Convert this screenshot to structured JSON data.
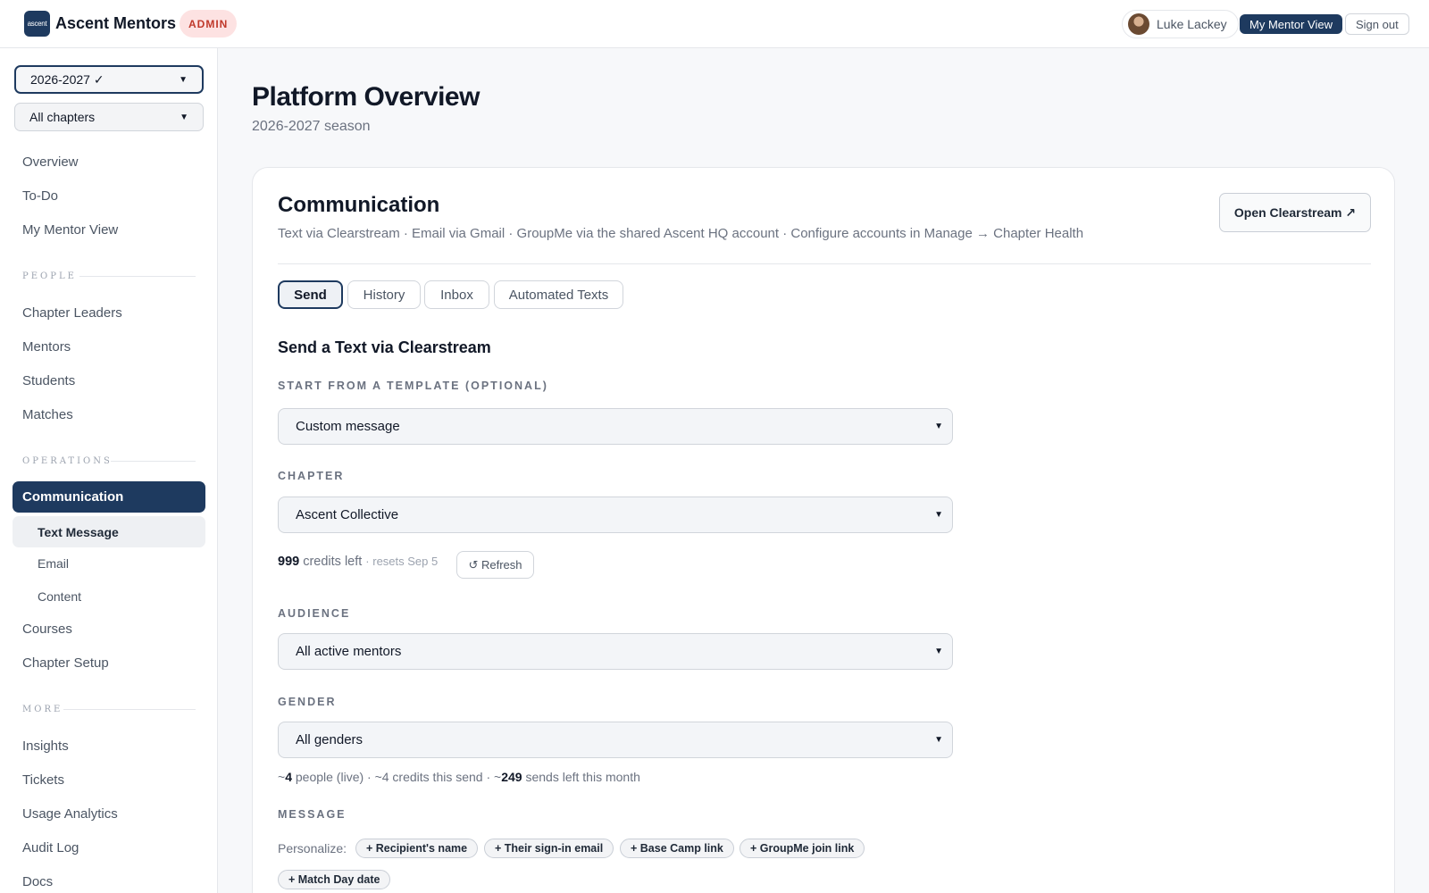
{
  "header": {
    "logo_text": "ascent",
    "brand": "Ascent Mentors",
    "badge": "ADMIN",
    "user_name": "Luke Lackey",
    "mentor_view_label": "My Mentor View",
    "sign_out_label": "Sign out"
  },
  "sidebar": {
    "season_select": "2026-2027 ✓",
    "chapter_select": "All chapters",
    "top_items": [
      "Overview",
      "To-Do",
      "My Mentor View"
    ],
    "people_label": "PEOPLE",
    "people_items": [
      "Chapter Leaders",
      "Mentors",
      "Students",
      "Matches"
    ],
    "operations_label": "OPERATIONS",
    "communication": "Communication",
    "comm_sub": [
      "Text Message",
      "Email",
      "Content"
    ],
    "ops_items": [
      "Courses",
      "Chapter Setup"
    ],
    "more_label": "MORE",
    "more_items": [
      "Insights",
      "Tickets",
      "Usage Analytics",
      "Audit Log",
      "Docs"
    ]
  },
  "page": {
    "title": "Platform Overview",
    "subtitle": "2026-2027 season"
  },
  "card": {
    "title": "Communication",
    "description": "Text via Clearstream · Email via Gmail · GroupMe via the shared Ascent HQ account · Configure accounts in Manage → Chapter Health",
    "open_button": "Open Clearstream ↗",
    "tabs": [
      "Send",
      "History",
      "Inbox",
      "Automated Texts"
    ],
    "active_tab": "Send",
    "section_heading": "Send a Text via Clearstream",
    "template_label": "START FROM A TEMPLATE (OPTIONAL)",
    "template_value": "Custom message",
    "chapter_label": "CHAPTER",
    "chapter_value": "Ascent Collective",
    "credits_count": "999",
    "credits_text": "credits left",
    "credits_reset": "· resets Sep 5",
    "refresh_label": "↺ Refresh",
    "audience_label": "AUDIENCE",
    "audience_value": "All active mentors",
    "gender_label": "GENDER",
    "gender_value": "All genders",
    "counts": {
      "prefix": "~",
      "people": "4",
      "people_text": "people (live) · ~4 credits this send · ~",
      "sends": "249",
      "sends_text": "sends left this month"
    },
    "message_label": "MESSAGE",
    "personalize_label": "Personalize:",
    "chips": [
      "+ Recipient's name",
      "+ Their sign-in email",
      "+ Base Camp link",
      "+ GroupMe join link",
      "+ Match Day date"
    ]
  },
  "colors": {
    "accent_navy": "#1e3a5f",
    "admin_badge_bg": "#fde2e2",
    "admin_badge_text": "#c0392b"
  }
}
